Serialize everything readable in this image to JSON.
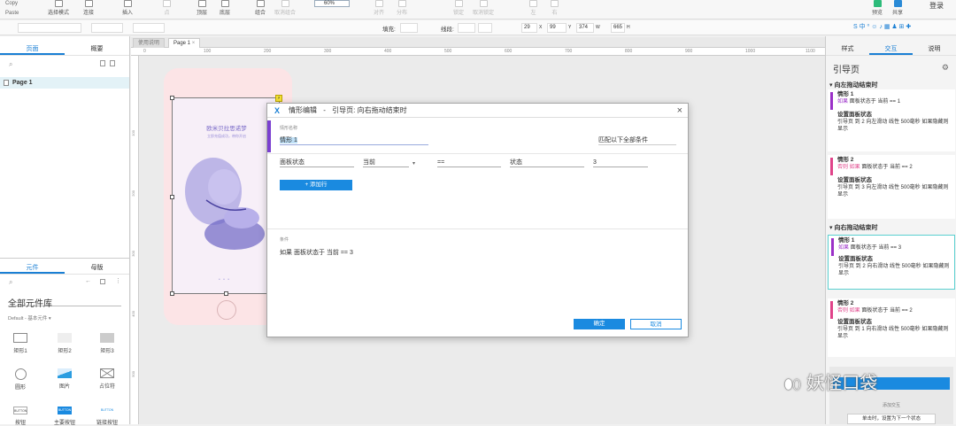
{
  "toolbar": {
    "copy": "Copy",
    "paste": "Paste",
    "items": [
      "选择模式",
      "连接",
      "插入",
      "点",
      "顶层",
      "底层",
      "组合",
      "取消组合",
      "对齐",
      "分布",
      "锁定",
      "取消锁定",
      "左",
      "右",
      "预览",
      "共享"
    ],
    "zoom": "60%",
    "login": "登录"
  },
  "format": {
    "fill_label": "填充:",
    "line_label": "线段:",
    "x": "29",
    "y": "99",
    "w": "374",
    "h": "665",
    "x_label": "X",
    "y_label": "Y",
    "w_label": "W",
    "h_label": "H"
  },
  "left_panel": {
    "tabs": [
      "页面",
      "概要"
    ],
    "page": "Page 1",
    "lib_tabs": [
      "元件",
      "母版"
    ],
    "library": "全部元件库",
    "lib_default": "Default - 基本元件",
    "widgets": [
      "矩形1",
      "矩形2",
      "矩形3",
      "圆形",
      "图片",
      "占位符",
      "按钮",
      "主要按钮",
      "链接按钮"
    ],
    "button_text": "BUTTON"
  },
  "tabs": [
    "使用说明",
    "Page 1"
  ],
  "ruler": [
    "0",
    "100",
    "200",
    "300",
    "400",
    "500",
    "600",
    "700",
    "800",
    "900",
    "1000",
    "1100",
    "1200"
  ],
  "vruler": [
    "100",
    "200",
    "300",
    "400",
    "500",
    "600"
  ],
  "phone": {
    "title": "欧米贝拉思诺梦",
    "sub": "立即充值成功，带你开启"
  },
  "dialog": {
    "title": "情形编辑",
    "sep": "-",
    "context": "引导页: 向右拖动结束时",
    "name_label": "情形名称",
    "name_value": "情形 1",
    "match": "匹配以下全部条件",
    "condition": [
      "面板状态",
      "当前",
      "==",
      "状态",
      "3"
    ],
    "add_row": "+ 添加行",
    "desc_label": "条件",
    "desc": "如果  面板状态于 当前 == 3",
    "ok": "确定",
    "cancel": "取消"
  },
  "right_panel": {
    "tabs": [
      "样式",
      "交互",
      "说明"
    ],
    "title": "引导页",
    "sections": [
      {
        "name": "向左拖动结束时",
        "cases": [
          {
            "title": "情形 1",
            "cond_kw": "如果",
            "cond": "面板状态于 当前 == 1",
            "action": "设置面板状态",
            "detail": "引导页 到 2 向左滑动 线性 500毫秒 如果隐藏则显示",
            "color": "#9b30c8"
          },
          {
            "title": "情形 2",
            "cond_kw": "否则 如果",
            "cond": "面板状态于 当前 == 2",
            "action": "设置面板状态",
            "detail": "引导页 到 3 向左滑动 线性 500毫秒 如果隐藏则显示",
            "color": "#e0438a"
          }
        ]
      },
      {
        "name": "向右拖动结束时",
        "cases": [
          {
            "title": "情形 1",
            "cond_kw": "如果",
            "cond": "面板状态于 当前 == 3",
            "action": "设置面板状态",
            "detail": "引导页 到 2 向右滑动 线性 500毫秒 如果隐藏则显示",
            "color": "#9b30c8"
          },
          {
            "title": "情形 2",
            "cond_kw": "否则 如果",
            "cond": "面板状态于 当前 == 2",
            "action": "设置面板状态",
            "detail": "引导页 到 1 向右滑动 线性 500毫秒 如果隐藏则显示",
            "color": "#e0438a"
          }
        ]
      }
    ],
    "bottom_caption": "添加交互",
    "bottom_action": "单击时，设置为下一个状态"
  },
  "watermark": "妖怪口袋",
  "colors": {
    "accent": "#1a7fd4",
    "purple": "#7a3fd0",
    "teal_select": "#5ad0d0"
  }
}
